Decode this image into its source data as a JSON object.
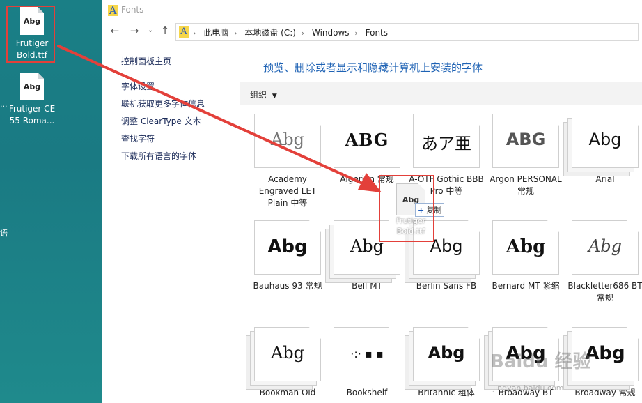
{
  "desktop": {
    "icons": [
      {
        "label": "Frutiger\nBold.ttf",
        "thumb": "Abg"
      },
      {
        "label": "Frutiger CE\n55 Roma...",
        "thumb": "Abg"
      }
    ],
    "edge_text": [
      "...",
      "语"
    ]
  },
  "window": {
    "title": "Fonts",
    "breadcrumbs": [
      "此电脑",
      "本地磁盘 (C:)",
      "Windows",
      "Fonts"
    ]
  },
  "left_pane": {
    "links": [
      "控制面板主页",
      "字体设置",
      "联机获取更多字体信息",
      "调整 ClearType 文本",
      "查找字符",
      "下载所有语言的字体"
    ]
  },
  "content": {
    "heading": "预览、删除或者显示和隐藏计算机上安装的字体",
    "organize_label": "组织"
  },
  "fonts": [
    {
      "label": "Academy Engraved LET Plain 中等",
      "sample": "Abg"
    },
    {
      "label": "Algerian 常规",
      "sample": "ABG"
    },
    {
      "label": "A-OTF Gothic BBB Pro 中等",
      "sample": "あア亜"
    },
    {
      "label": "Argon PERSONAL 常规",
      "sample": "ABG"
    },
    {
      "label": "Arial",
      "sample": "Abg"
    },
    {
      "label": "Bauhaus 93 常规",
      "sample": "Abg"
    },
    {
      "label": "Bell MT",
      "sample": "Abg"
    },
    {
      "label": "Berlin Sans FB",
      "sample": "Abg"
    },
    {
      "label": "Bernard MT 紧缩",
      "sample": "Abg"
    },
    {
      "label": "Blackletter686 BT 常规",
      "sample": "Abg"
    },
    {
      "label": "Bookman Old",
      "sample": "Abg"
    },
    {
      "label": "Bookshelf",
      "sample": "·:· ▪ ▪"
    },
    {
      "label": "Britannic 粗体",
      "sample": "Abg"
    },
    {
      "label": "Broadway BT",
      "sample": "Abg"
    },
    {
      "label": "Broadway 常规",
      "sample": "Abg"
    }
  ],
  "drag": {
    "ghost_thumb": "Abg",
    "ghost_name": "Frutiger Bold.ttf",
    "tooltip": "复制"
  },
  "watermark": {
    "main": "Baidu 经验",
    "sub": "jingyan.baidu.com"
  },
  "colors": {
    "annotation_red": "#e3403a",
    "heading_blue": "#1e62b4",
    "desktop_teal": "#1a7f86"
  }
}
